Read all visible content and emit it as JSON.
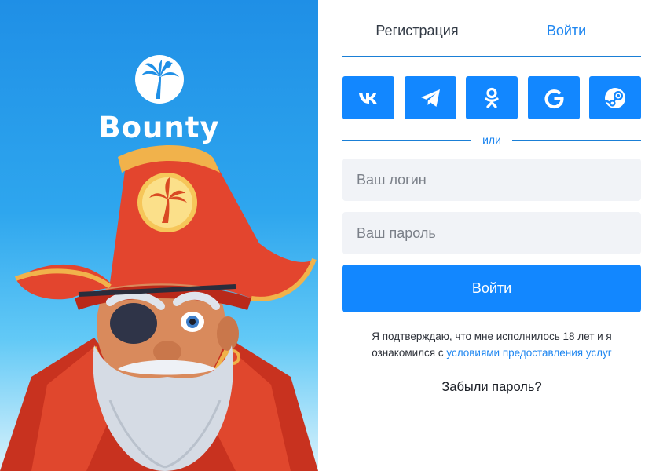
{
  "brand": {
    "name": "Bounty",
    "colors": {
      "primary": "#1287ff",
      "link": "#1e86f0",
      "bg_top": "#1f8fe6",
      "field_bg": "#f1f3f7"
    }
  },
  "tabs": [
    {
      "label": "Регистрация",
      "active": false
    },
    {
      "label": "Войти",
      "active": true
    }
  ],
  "social": [
    {
      "icon": "vk-icon",
      "label": "VK"
    },
    {
      "icon": "telegram-icon",
      "label": "Telegram"
    },
    {
      "icon": "odnoklassniki-icon",
      "label": "Odnoklassniki"
    },
    {
      "icon": "google-icon",
      "label": "Google"
    },
    {
      "icon": "steam-icon",
      "label": "Steam"
    }
  ],
  "divider_text": "или",
  "form": {
    "login_placeholder": "Ваш логин",
    "password_placeholder": "Ваш пароль",
    "submit_label": "Войти"
  },
  "consent": {
    "text": "Я подтверждаю, что мне исполнилось 18 лет и я ознакомился с ",
    "link": "условиями предоставления услуг"
  },
  "forgot_label": "Забыли пароль?"
}
